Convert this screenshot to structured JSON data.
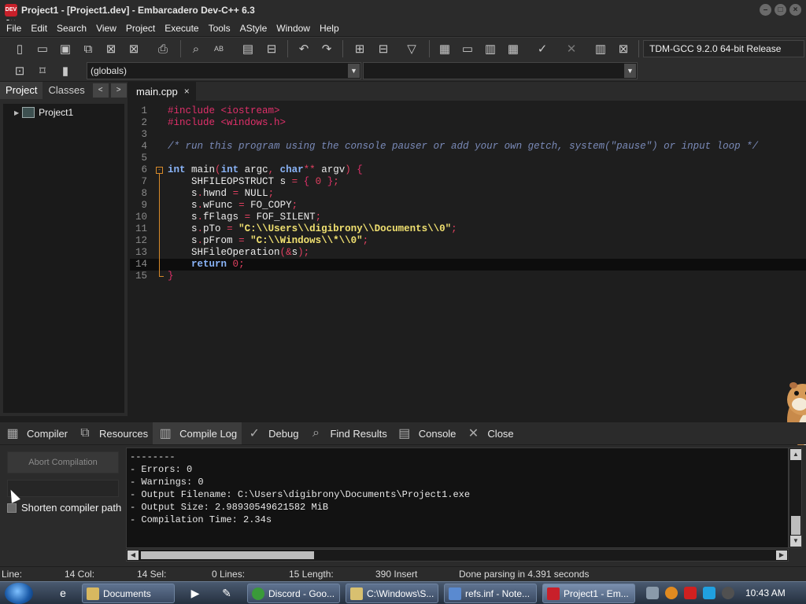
{
  "window": {
    "title": "Project1 - [Project1.dev] - Embarcadero Dev-C++ 6.3",
    "app_icon_text": "DEV C++"
  },
  "menu": [
    "File",
    "Edit",
    "Search",
    "View",
    "Project",
    "Execute",
    "Tools",
    "AStyle",
    "Window",
    "Help"
  ],
  "toolbar": {
    "compiler": "TDM-GCC 9.2.0 64-bit Release",
    "scope_combo": "(globals)",
    "member_combo": ""
  },
  "left_panel": {
    "tabs": [
      "Project",
      "Classes"
    ],
    "nav_prev": "<",
    "nav_next": ">",
    "tree_root": "Project1"
  },
  "editor": {
    "tab_label": "main.cpp",
    "tab_close": "×",
    "current_line": 14,
    "lines": [
      {
        "n": "1",
        "text": "#include <iostream>"
      },
      {
        "n": "2",
        "text": "#include <windows.h>"
      },
      {
        "n": "3",
        "text": ""
      },
      {
        "n": "4",
        "text": "/* run this program using the console pauser or add your own getch, system(\"pause\") or input loop */"
      },
      {
        "n": "5",
        "text": ""
      },
      {
        "n": "6",
        "text": "int main(int argc, char** argv) {"
      },
      {
        "n": "7",
        "text": "    SHFILEOPSTRUCT s = { 0 };"
      },
      {
        "n": "8",
        "text": "    s.hwnd = NULL;"
      },
      {
        "n": "9",
        "text": "    s.wFunc = FO_COPY;"
      },
      {
        "n": "10",
        "text": "    s.fFlags = FOF_SILENT;"
      },
      {
        "n": "11",
        "text": "    s.pTo = \"C:\\\\Users\\\\digibrony\\\\Documents\\\\0\";"
      },
      {
        "n": "12",
        "text": "    s.pFrom = \"C:\\\\Windows\\\\*\\\\0\";"
      },
      {
        "n": "13",
        "text": "    SHFileOperation(&s);"
      },
      {
        "n": "14",
        "text": "    return 0;"
      },
      {
        "n": "15",
        "text": "}"
      }
    ]
  },
  "bottom_tabs": [
    "Compiler",
    "Resources",
    "Compile Log",
    "Debug",
    "Find Results",
    "Console",
    "Close"
  ],
  "bottom_tab_active": "Compile Log",
  "compile_panel": {
    "abort_label": "Abort Compilation",
    "shorten_label": "Shorten compiler path",
    "log_lines": [
      "--------",
      "- Errors: 0",
      "- Warnings: 0",
      "- Output Filename: C:\\Users\\digibrony\\Documents\\Project1.exe",
      "- Output Size: 2.98930549621582 MiB",
      "- Compilation Time: 2.34s"
    ]
  },
  "status": {
    "line": "Line:",
    "col": "14 Col:",
    "sel": "14 Sel:",
    "lines": "0 Lines:",
    "length": "15 Length:",
    "insert": "390 Insert",
    "message": "Done parsing in 4.391 seconds"
  },
  "taskbar": {
    "buttons": [
      {
        "label": "Documents",
        "color": "#d8b860"
      },
      {
        "label": "Discord - Goo...",
        "color": "#3a9a3a"
      },
      {
        "label": "C:\\Windows\\S...",
        "color": "#d8c070"
      },
      {
        "label": "refs.inf - Note...",
        "color": "#5a8ad0"
      },
      {
        "label": "Project1 - Em...",
        "color": "#c8202a"
      }
    ],
    "clock": "10:43 AM"
  }
}
